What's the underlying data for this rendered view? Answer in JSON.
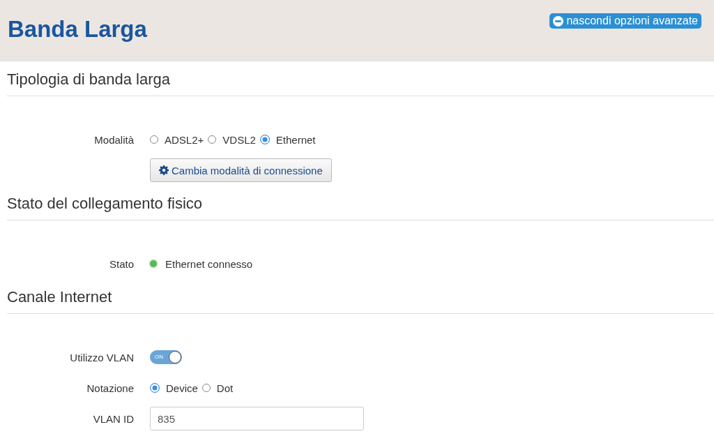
{
  "header": {
    "title": "Banda Larga",
    "toggle_button": "nascondi opzioni avanzate"
  },
  "sections": [
    {
      "title": "Tipologia di banda larga",
      "rows": [
        {
          "kind": "radio",
          "label": "Modalità",
          "options": [
            {
              "label": "ADSL2+",
              "selected": false
            },
            {
              "label": "VDSL2",
              "selected": false
            },
            {
              "label": "Ethernet",
              "selected": true
            }
          ]
        },
        {
          "kind": "button",
          "text": "Cambia modalità di connessione"
        }
      ]
    },
    {
      "title": "Stato del collegamento fisico",
      "rows": [
        {
          "kind": "status",
          "label": "Stato",
          "text": "Ethernet connesso",
          "color": "#5cb85c"
        }
      ]
    },
    {
      "title": "Canale Internet",
      "rows": [
        {
          "kind": "switch",
          "label": "Utilizzo VLAN",
          "on": true,
          "text": "ON"
        },
        {
          "kind": "radio",
          "label": "Notazione",
          "options": [
            {
              "label": "Device",
              "selected": true
            },
            {
              "label": "Dot",
              "selected": false
            }
          ]
        },
        {
          "kind": "input",
          "label": "VLAN ID",
          "value": "835"
        }
      ]
    }
  ]
}
